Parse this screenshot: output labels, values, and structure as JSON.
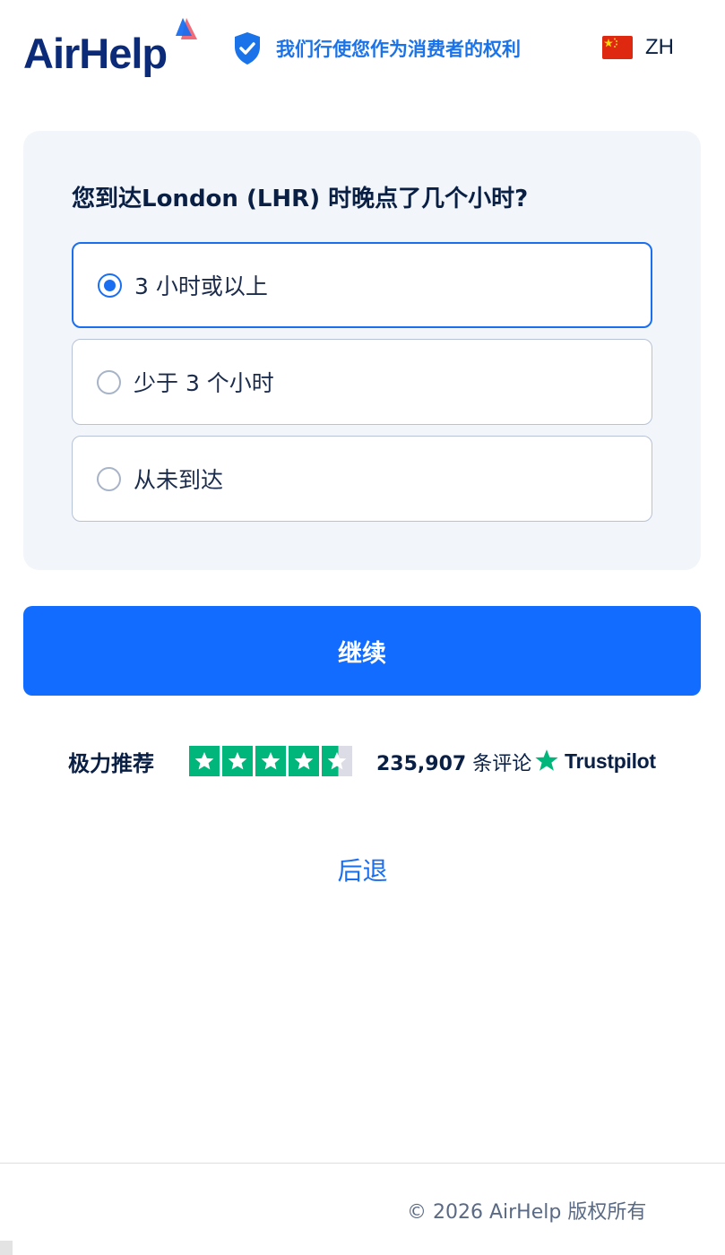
{
  "header": {
    "logo_text": "AirHelp",
    "rights_text": "我们行使您作为消费者的权利",
    "language_code": "ZH"
  },
  "form": {
    "question": "您到达London (LHR) 时晚点了几个小时?",
    "options": [
      {
        "label": "3 小时或以上",
        "selected": true
      },
      {
        "label": "少于 3 个小时",
        "selected": false
      },
      {
        "label": "从未到达",
        "selected": false
      }
    ],
    "continue_label": "继续"
  },
  "rating": {
    "word": "极力推荐",
    "stars": 4.5,
    "review_count": "235,907",
    "review_suffix": "条评论",
    "provider": "Trustpilot"
  },
  "navigation": {
    "back_label": "后退"
  },
  "footer": {
    "copyright": "© 2026 AirHelp 版权所有"
  },
  "colors": {
    "brand_blue": "#116cff",
    "navy": "#0a1f44",
    "trustpilot_green": "#00b67a"
  }
}
